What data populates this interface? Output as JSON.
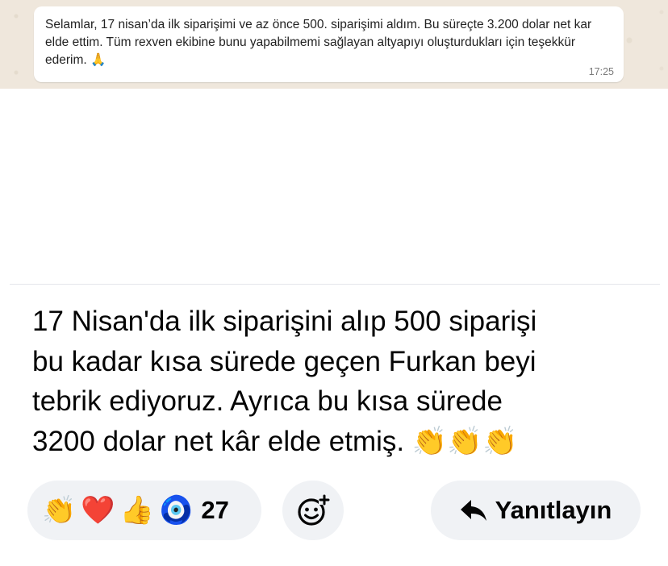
{
  "chat_message": {
    "text": "Selamlar, 17 nisan’da ilk siparişimi ve az önce 500. siparişimi aldım. Bu süreçte 3.200 dolar net kar elde ettim. Tüm rexven ekibine bunu yapabilmemi sağlayan altyapıyı oluşturdukları için teşekkür ederim. 🙏",
    "time": "17:25"
  },
  "post": {
    "text": "17 Nisan'da ilk siparişini alıp 500 siparişi\nbu kadar kısa sürede geçen Furkan beyi\ntebrik ediyoruz. Ayrıca bu kısa sürede\n3200 dolar net kâr elde etmiş. 👏👏👏"
  },
  "reactions": {
    "emojis": [
      "👏",
      "❤️",
      "👍",
      "🧿"
    ],
    "count": "27"
  },
  "actions": {
    "reply_label": "Yanıtlayın",
    "reply_icon": "reply-arrow-icon",
    "add_reaction_icon": "add-reaction-smiley-icon"
  }
}
